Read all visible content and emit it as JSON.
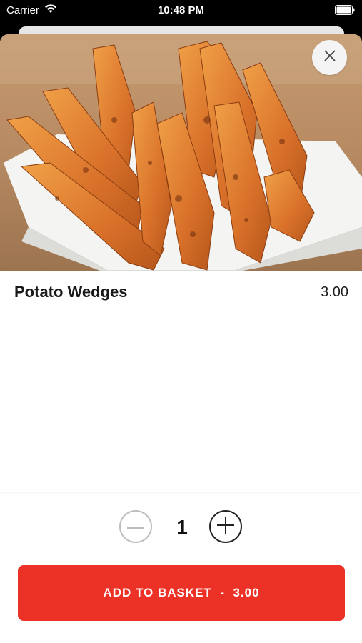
{
  "status_bar": {
    "carrier": "Carrier",
    "time": "10:48 PM"
  },
  "product": {
    "name": "Potato Wedges",
    "price": "3.00",
    "image_icon": "potato-wedges-photo"
  },
  "quantity": {
    "value": "1",
    "minus_icon": "minus-icon",
    "plus_icon": "plus-icon"
  },
  "add_button": {
    "label": "ADD TO BASKET",
    "separator": "-",
    "amount": "3.00"
  },
  "colors": {
    "accent": "#ec3226",
    "text": "#1a1a1a"
  }
}
